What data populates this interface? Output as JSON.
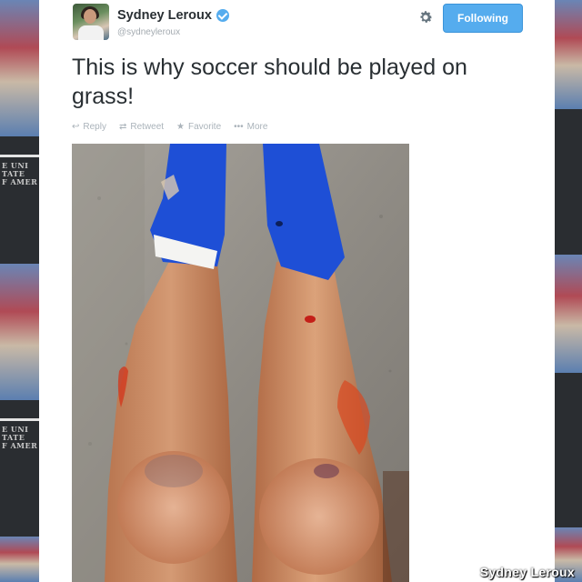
{
  "tweet": {
    "author": {
      "display_name": "Sydney Leroux",
      "handle": "@sydneyleroux",
      "verified": true
    },
    "follow_label": "Following",
    "text": "This is why soccer should be played on grass!",
    "actions": [
      {
        "label": "Reply",
        "icon": "reply-icon",
        "glyph": "↩"
      },
      {
        "label": "Retweet",
        "icon": "retweet-icon",
        "glyph": "⇄"
      },
      {
        "label": "Favorite",
        "icon": "star-icon",
        "glyph": "★"
      },
      {
        "label": "More",
        "icon": "more-icon",
        "glyph": "•••"
      }
    ],
    "photo": {
      "subject": "injured-legs-photo"
    }
  },
  "side_shirt_text": [
    "E UNI",
    "TATE",
    "F AMER"
  ],
  "credit": "Sydney Leroux",
  "colors": {
    "accent": "#55acee",
    "text": "#292f33",
    "muted": "#aab3ba"
  }
}
